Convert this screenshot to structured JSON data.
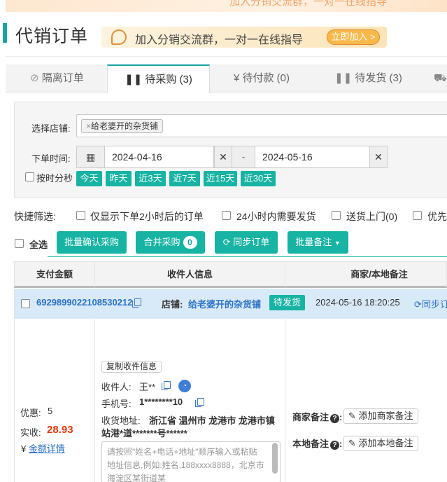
{
  "banner": {
    "text": "加入分销交流群，一对一在线指导"
  },
  "page": {
    "title": "代销订单"
  },
  "promo": {
    "text": "加入分销交流群，一对一在线指导",
    "button": "立即加入 >"
  },
  "tabs": [
    {
      "label": "隔离订单",
      "icon": "eye-slash-icon"
    },
    {
      "label": "待采购 (3)",
      "icon": "pause-icon"
    },
    {
      "label": "¥ 待付款 (0)",
      "icon": "yen-icon"
    },
    {
      "label": "待发货 (3)",
      "icon": "pause-icon"
    },
    {
      "label": "",
      "icon": "truck-icon"
    }
  ],
  "filter": {
    "shop_label": "选择店铺:",
    "shop_chip": "给老婆开的杂货铺",
    "time_label": "下单时间:",
    "date_from": "2024-04-16",
    "date_to": "2024-05-16",
    "date_sep": "-",
    "by_hour_label": "按时分秒",
    "quick_ranges": [
      "今天",
      "昨天",
      "近3天",
      "近7天",
      "近15天",
      "近30天"
    ]
  },
  "quick_filter": {
    "label": "快捷筛选:",
    "options": [
      "仅显示下单2小时后的订单",
      "24小时内需要发货",
      "送货上门(0)",
      "优先"
    ]
  },
  "actions": {
    "select_all": "全选",
    "batch_confirm": "批量确认采购",
    "merge": "合并采购",
    "merge_count": "0",
    "sync": "同步订单",
    "batch_note": "批量备注"
  },
  "table": {
    "headers": [
      "支付金额",
      "收件人信息",
      "商家/本地备注"
    ]
  },
  "order": {
    "id": "6929899022108530212",
    "shop_label": "店铺:",
    "shop_name": "给老婆开的杂货铺",
    "status": "待发货",
    "time": "2024-05-16 18:20:25",
    "sync_label": "同步订",
    "discount_label": "优惠:",
    "discount_value": "5",
    "paid_label": "实收:",
    "paid_value": "28.93",
    "amount_detail": "金额详情",
    "copy_receiver": "复制收件信息",
    "receiver_label": "收件人:",
    "receiver_name": "王**",
    "phone_label": "手机号:",
    "phone_value": "1********10",
    "address_label": "收货地址:",
    "address_line1": "浙江省 温州市 龙港市 龙港市镇",
    "address_line2": "站港*道*******号******",
    "address_placeholder": "请按照\"姓名+电话+地址\"顺序输入或粘贴地址信息,例如:姓名,188xxxx8888，北京市海淀区某街道某",
    "merchant_note_label": "商家备注",
    "merchant_note_btn": "添加商家备注",
    "local_note_label": "本地备注",
    "local_note_btn": "添加本地备注"
  },
  "colors": {
    "accent": "#17b3a3",
    "link": "#2a72c7",
    "price": "#e8380d"
  }
}
